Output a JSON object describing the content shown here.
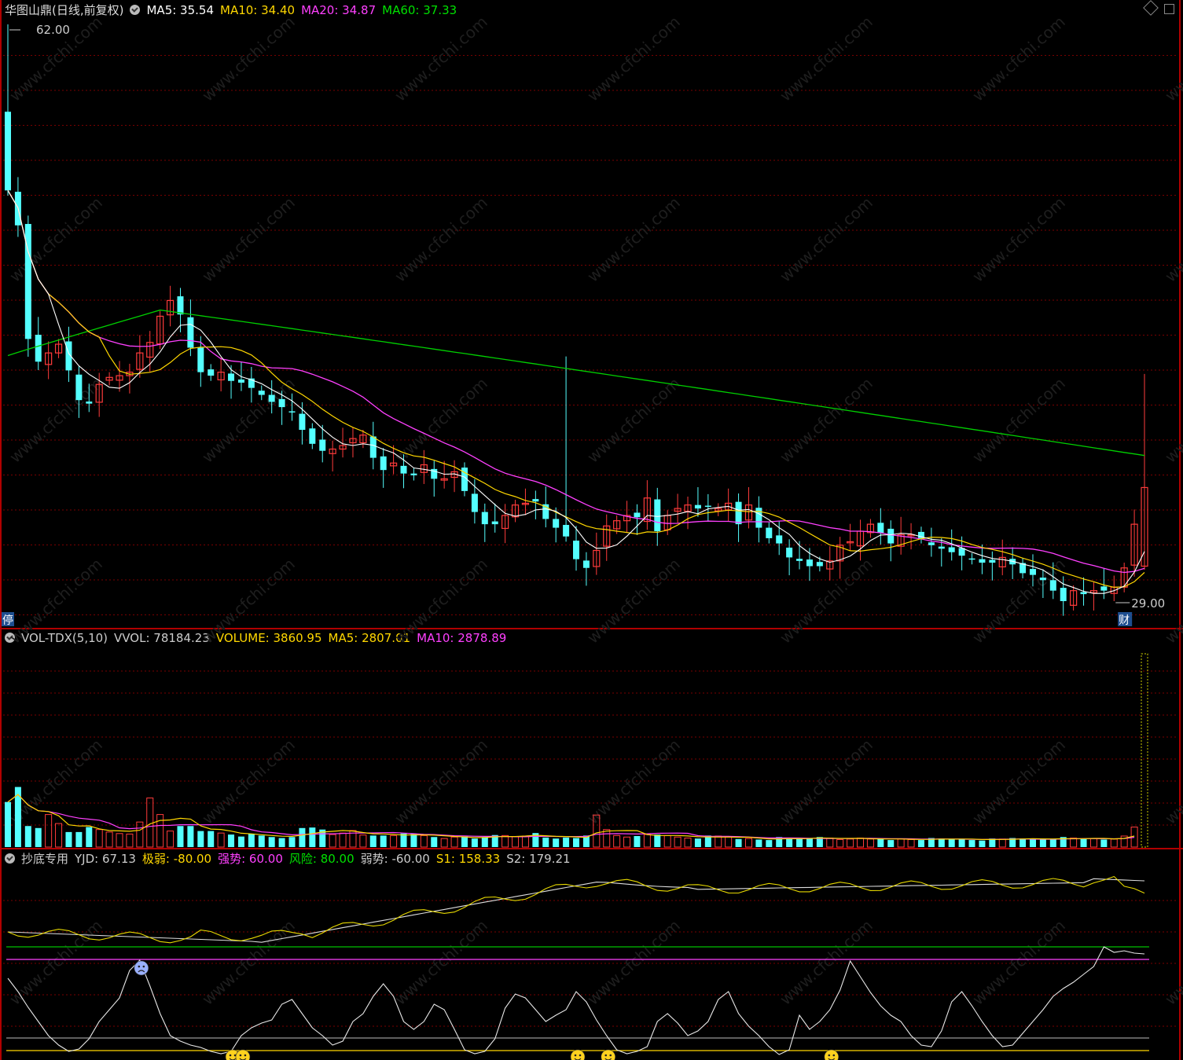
{
  "header_main": {
    "title": "华图山鼎(日线,前复权)",
    "ma5": "MA5: 35.54",
    "ma10": "MA10: 34.40",
    "ma20": "MA20: 34.87",
    "ma60": "MA60: 37.33"
  },
  "header_vol": {
    "name": "VOL-TDX(5,10)",
    "vvol": "VVOL: 78184.23",
    "volume": "VOLUME: 3860.95",
    "ma5": "MA5: 2807.01",
    "ma10": "MA10: 2878.89"
  },
  "header_ind": {
    "name": "抄底专用",
    "yjd": "YJD: 67.13",
    "jr": "极弱: -80.00",
    "qs": "强势: 60.00",
    "fx": "风险: 80.00",
    "rs": "弱势: -60.00",
    "s1": "S1: 158.33",
    "s2": "S2: 179.21"
  },
  "annotations": {
    "high": "62.00",
    "low": "29.00",
    "ting": "停",
    "cai": "财",
    "watermark": "www.cfchi.com"
  },
  "colors": {
    "up": "#ff3b3b",
    "down": "#54ffff",
    "ma5": "#ffffff",
    "ma10": "#ffd700",
    "ma20": "#ff40ff",
    "ma60": "#00d000",
    "grid": "#7a0000",
    "border": "#b00000"
  },
  "chart_data": [
    {
      "type": "candlestick",
      "title": "华图山鼎(日线,前复权)",
      "price_high_marker": 62.0,
      "price_low_marker": 29.0,
      "closes": [
        52.5,
        50.5,
        44.0,
        42.7,
        43.2,
        43.7,
        42.2,
        40.5,
        40.3,
        41.4,
        41.8,
        41.9,
        42.1,
        43.2,
        43.8,
        45.3,
        46.2,
        45.4,
        43.5,
        42.1,
        41.9,
        42.1,
        41.6,
        41.5,
        41.2,
        40.8,
        40.4,
        40.1,
        39.8,
        38.8,
        38.0,
        37.6,
        37.7,
        37.9,
        38.3,
        38.5,
        37.2,
        36.5,
        36.9,
        36.3,
        36.2,
        36.8,
        36.0,
        36.0,
        36.4,
        35.3,
        34.1,
        33.4,
        33.4,
        33.9,
        34.5,
        34.6,
        34.7,
        33.7,
        33.2,
        32.7,
        31.4,
        30.9,
        31.9,
        33.3,
        33.6,
        33.9,
        33.8,
        34.9,
        33.0,
        33.9,
        34.3,
        34.5,
        34.3,
        34.4,
        34.3,
        34.6,
        33.4,
        34.5,
        33.2,
        32.6,
        32.3,
        31.5,
        31.3,
        31.0,
        31.0,
        31.3,
        32.2,
        32.4,
        33.0,
        33.4,
        32.9,
        32.3,
        32.8,
        32.8,
        32.6,
        32.2,
        32.0,
        31.8,
        31.6,
        31.4,
        31.2,
        31.2,
        31.5,
        31.1,
        30.6,
        30.5,
        30.2,
        29.6,
        29.0,
        29.6,
        29.4,
        29.6,
        29.6,
        29.8,
        30.9,
        33.4,
        35.5
      ],
      "ma60_final": 37.33
    },
    {
      "type": "bar",
      "title": "VOL-TDX(5,10)",
      "series": [
        {
          "name": "VOLUME",
          "last": 3860.95
        },
        {
          "name": "MA5",
          "last": 2807.01
        },
        {
          "name": "MA10",
          "last": 2878.89
        }
      ],
      "vvol": 78184.23,
      "values": [
        900,
        1200,
        420,
        380,
        650,
        470,
        300,
        300,
        400,
        350,
        300,
        270,
        260,
        500,
        980,
        650,
        320,
        420,
        420,
        320,
        320,
        280,
        250,
        210,
        260,
        230,
        200,
        180,
        200,
        380,
        390,
        350,
        250,
        280,
        330,
        240,
        230,
        230,
        230,
        270,
        260,
        230,
        200,
        170,
        200,
        210,
        170,
        200,
        240,
        230,
        210,
        220,
        280,
        190,
        170,
        190,
        180,
        230,
        640,
        350,
        230,
        200,
        220,
        250,
        250,
        230,
        200,
        180,
        170,
        230,
        220,
        200,
        160,
        170,
        150,
        140,
        200,
        180,
        160,
        170,
        200,
        180,
        150,
        160,
        180,
        160,
        170,
        140,
        160,
        150,
        140,
        180,
        170,
        150,
        160,
        140,
        130,
        170,
        160,
        180,
        170,
        160,
        150,
        150,
        200,
        180,
        160,
        170,
        150,
        160,
        220,
        400,
        3860.95
      ]
    },
    {
      "type": "line",
      "title": "抄底专用",
      "series": [
        {
          "name": "YJD",
          "last": 67.13
        },
        {
          "name": "S1",
          "last": 158.33
        },
        {
          "name": "S2",
          "last": 179.21
        }
      ],
      "levels": {
        "极弱": -80,
        "强势": 60,
        "风险": 80,
        "弱势": -60
      }
    }
  ]
}
